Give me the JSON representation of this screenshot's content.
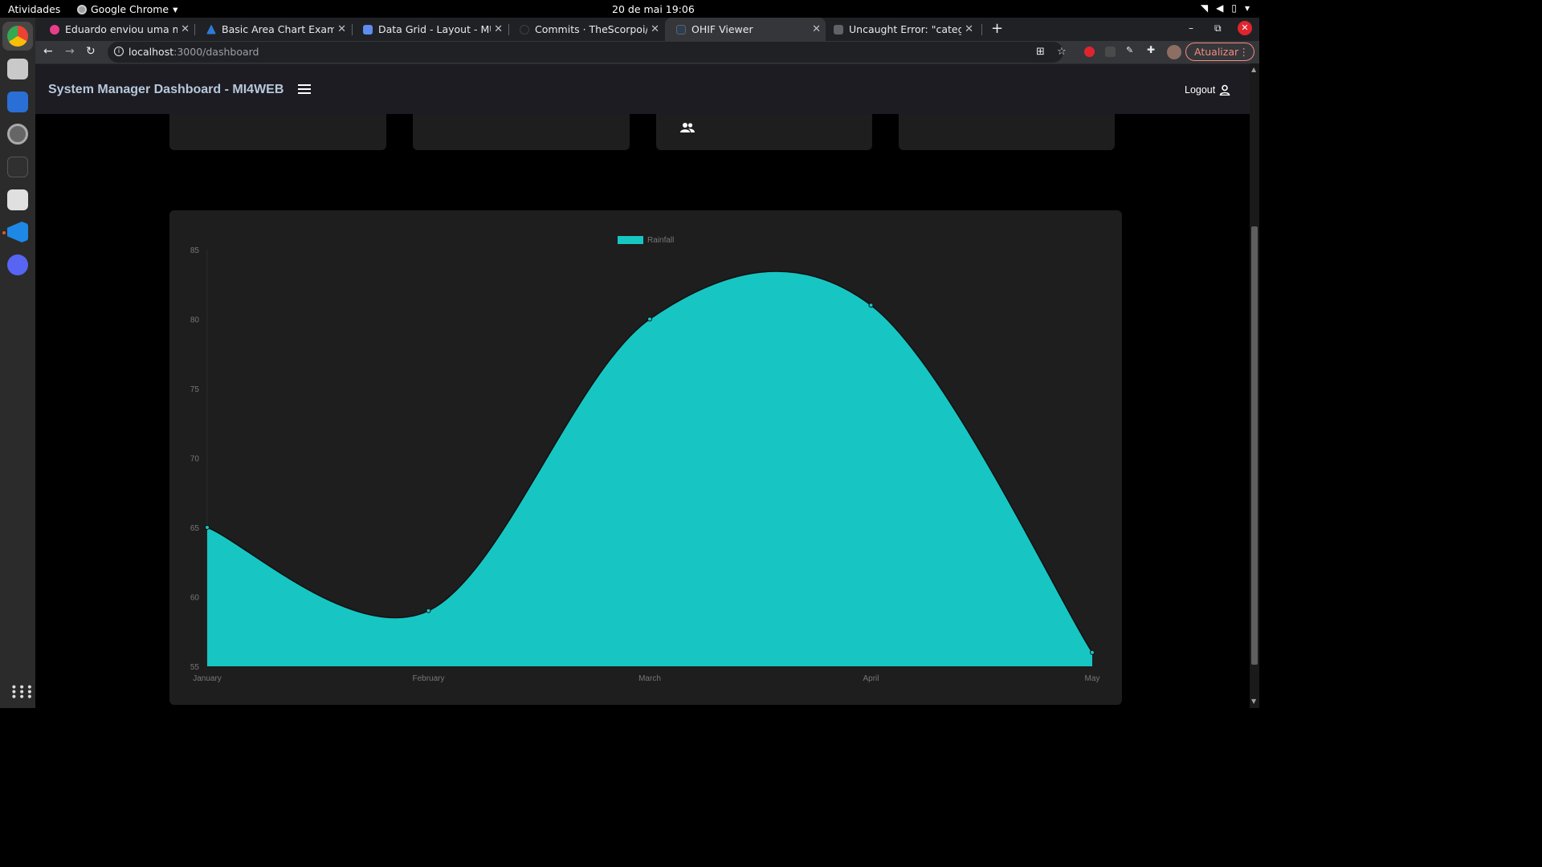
{
  "os": {
    "activities": "Atividades",
    "app_name": "Google Chrome",
    "clock": "20 de mai  19:06"
  },
  "browser": {
    "tabs": [
      {
        "title": "Eduardo enviou uma men",
        "icon": "messenger-icon",
        "color": "#e83e8c"
      },
      {
        "title": "Basic Area Chart Example",
        "icon": "apexcharts-icon",
        "color": "#2d7bd6"
      },
      {
        "title": "Data Grid - Layout - MUI X",
        "icon": "mui-icon",
        "color": "#5e8cf0"
      },
      {
        "title": "Commits · TheScorpoi/mi",
        "icon": "github-icon",
        "color": "#202124"
      },
      {
        "title": "OHIF Viewer",
        "icon": "ohif-icon",
        "color": "#2c3e50"
      },
      {
        "title": "Uncaught Error: \"categor",
        "icon": "stackoverflow-icon",
        "color": "#5f6368"
      }
    ],
    "active_tab": 4,
    "url_host": "localhost",
    "url_path": ":3000/dashboard",
    "update_label": "Atualizar"
  },
  "app": {
    "title": "System Manager Dashboard - MI4WEB",
    "logout_label": "Logout"
  },
  "chart_data": {
    "type": "area",
    "categories": [
      "January",
      "February",
      "March",
      "April",
      "May"
    ],
    "series": [
      {
        "name": "Rainfall",
        "values": [
          65,
          59,
          80,
          81,
          56
        ]
      }
    ],
    "ylim": [
      55,
      85
    ],
    "yticks": [
      55,
      60,
      65,
      70,
      75,
      80,
      85
    ],
    "legend": "top-center",
    "grid": false,
    "colors": {
      "fill": "#17c6c3",
      "stroke": "#111111"
    }
  }
}
